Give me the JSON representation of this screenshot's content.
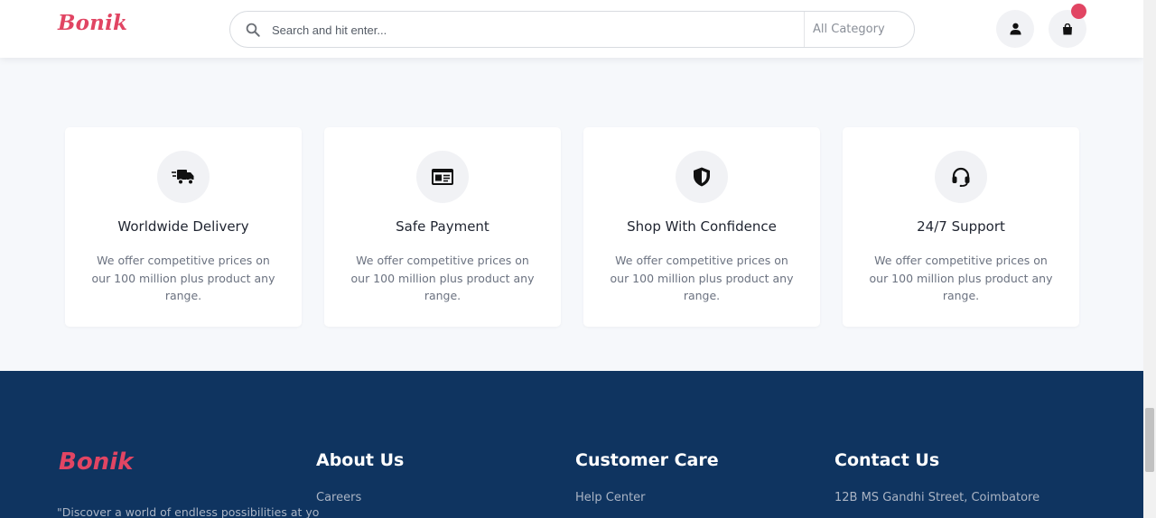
{
  "header": {
    "logo": "Bonik",
    "search": {
      "placeholder": "Search and hit enter..."
    },
    "category_label": "All Category"
  },
  "features": [
    {
      "title": "Worldwide Delivery",
      "description": "We offer competitive prices on our 100 million plus product any range.",
      "icon": "truck-icon"
    },
    {
      "title": "Safe Payment",
      "description": "We offer competitive prices on our 100 million plus product any range.",
      "icon": "id-card-icon"
    },
    {
      "title": "Shop With Confidence",
      "description": "We offer competitive prices on our 100 million plus product any range.",
      "icon": "shield-icon"
    },
    {
      "title": "24/7 Support",
      "description": "We offer competitive prices on our 100 million plus product any range.",
      "icon": "headset-icon"
    }
  ],
  "footer": {
    "logo": "Bonik",
    "tagline": "\"Discover a world of endless possibilities at your",
    "columns": [
      {
        "heading": "About Us",
        "links": [
          "Careers"
        ]
      },
      {
        "heading": "Customer Care",
        "links": [
          "Help Center"
        ]
      },
      {
        "heading": "Contact Us",
        "links": [
          "12B MS Gandhi Street, Coimbatore"
        ]
      }
    ]
  },
  "colors": {
    "brand": "#e14563",
    "footer_bg": "#0f3460",
    "page_bg": "#f6f8fb"
  }
}
